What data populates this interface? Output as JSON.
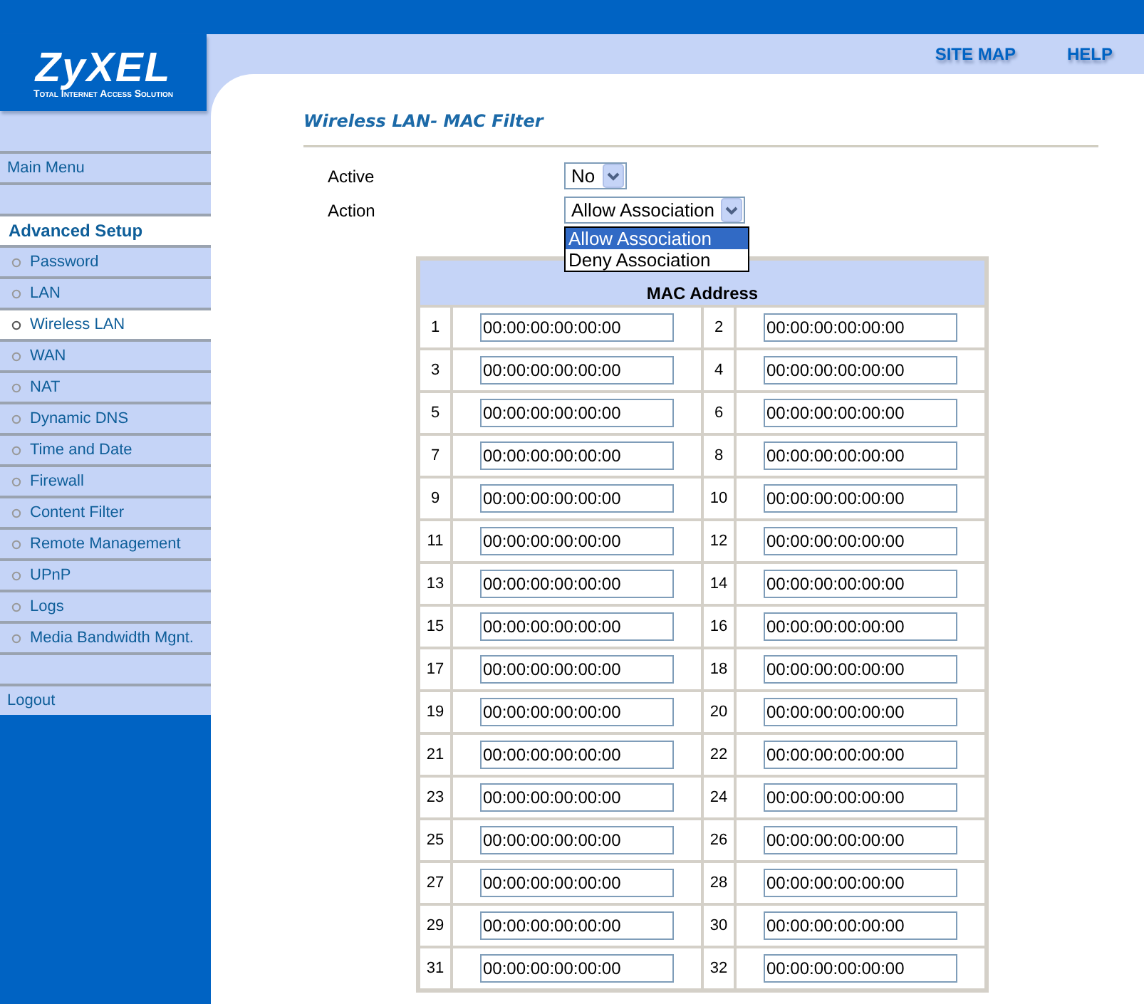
{
  "logo": {
    "name": "ZyXEL",
    "tagline": "Total Internet Access Solution"
  },
  "header_links": [
    "SITE MAP",
    "HELP"
  ],
  "sidebar": {
    "main_menu": "Main Menu",
    "section": "Advanced Setup",
    "items": [
      {
        "label": "Password",
        "selected": false
      },
      {
        "label": "LAN",
        "selected": false
      },
      {
        "label": "Wireless LAN",
        "selected": true
      },
      {
        "label": "WAN",
        "selected": false
      },
      {
        "label": "NAT",
        "selected": false
      },
      {
        "label": "Dynamic DNS",
        "selected": false
      },
      {
        "label": "Time and Date",
        "selected": false
      },
      {
        "label": "Firewall",
        "selected": false
      },
      {
        "label": "Content Filter",
        "selected": false
      },
      {
        "label": "Remote Management",
        "selected": false
      },
      {
        "label": "UPnP",
        "selected": false
      },
      {
        "label": "Logs",
        "selected": false
      },
      {
        "label": "Media Bandwidth Mgnt.",
        "selected": false
      }
    ],
    "logout": "Logout"
  },
  "page_title": "Wireless LAN- MAC Filter",
  "form": [
    {
      "label": "Active",
      "value": "No"
    },
    {
      "label": "Action",
      "value": "Allow Association",
      "options": [
        {
          "label": "Allow Association",
          "selected": true
        },
        {
          "label": "Deny Association",
          "selected": false
        }
      ]
    }
  ],
  "table": {
    "header": "MAC Address",
    "entries": [
      {
        "number": "1",
        "value": "00:00:00:00:00:00"
      },
      {
        "number": "2",
        "value": "00:00:00:00:00:00"
      },
      {
        "number": "3",
        "value": "00:00:00:00:00:00"
      },
      {
        "number": "4",
        "value": "00:00:00:00:00:00"
      },
      {
        "number": "5",
        "value": "00:00:00:00:00:00"
      },
      {
        "number": "6",
        "value": "00:00:00:00:00:00"
      },
      {
        "number": "7",
        "value": "00:00:00:00:00:00"
      },
      {
        "number": "8",
        "value": "00:00:00:00:00:00"
      },
      {
        "number": "9",
        "value": "00:00:00:00:00:00"
      },
      {
        "number": "10",
        "value": "00:00:00:00:00:00"
      },
      {
        "number": "11",
        "value": "00:00:00:00:00:00"
      },
      {
        "number": "12",
        "value": "00:00:00:00:00:00"
      },
      {
        "number": "13",
        "value": "00:00:00:00:00:00"
      },
      {
        "number": "14",
        "value": "00:00:00:00:00:00"
      },
      {
        "number": "15",
        "value": "00:00:00:00:00:00"
      },
      {
        "number": "16",
        "value": "00:00:00:00:00:00"
      },
      {
        "number": "17",
        "value": "00:00:00:00:00:00"
      },
      {
        "number": "18",
        "value": "00:00:00:00:00:00"
      },
      {
        "number": "19",
        "value": "00:00:00:00:00:00"
      },
      {
        "number": "20",
        "value": "00:00:00:00:00:00"
      },
      {
        "number": "21",
        "value": "00:00:00:00:00:00"
      },
      {
        "number": "22",
        "value": "00:00:00:00:00:00"
      },
      {
        "number": "23",
        "value": "00:00:00:00:00:00"
      },
      {
        "number": "24",
        "value": "00:00:00:00:00:00"
      },
      {
        "number": "25",
        "value": "00:00:00:00:00:00"
      },
      {
        "number": "26",
        "value": "00:00:00:00:00:00"
      },
      {
        "number": "27",
        "value": "00:00:00:00:00:00"
      },
      {
        "number": "28",
        "value": "00:00:00:00:00:00"
      },
      {
        "number": "29",
        "value": "00:00:00:00:00:00"
      },
      {
        "number": "30",
        "value": "00:00:00:00:00:00"
      },
      {
        "number": "31",
        "value": "00:00:00:00:00:00"
      },
      {
        "number": "32",
        "value": "00:00:00:00:00:00"
      }
    ]
  }
}
